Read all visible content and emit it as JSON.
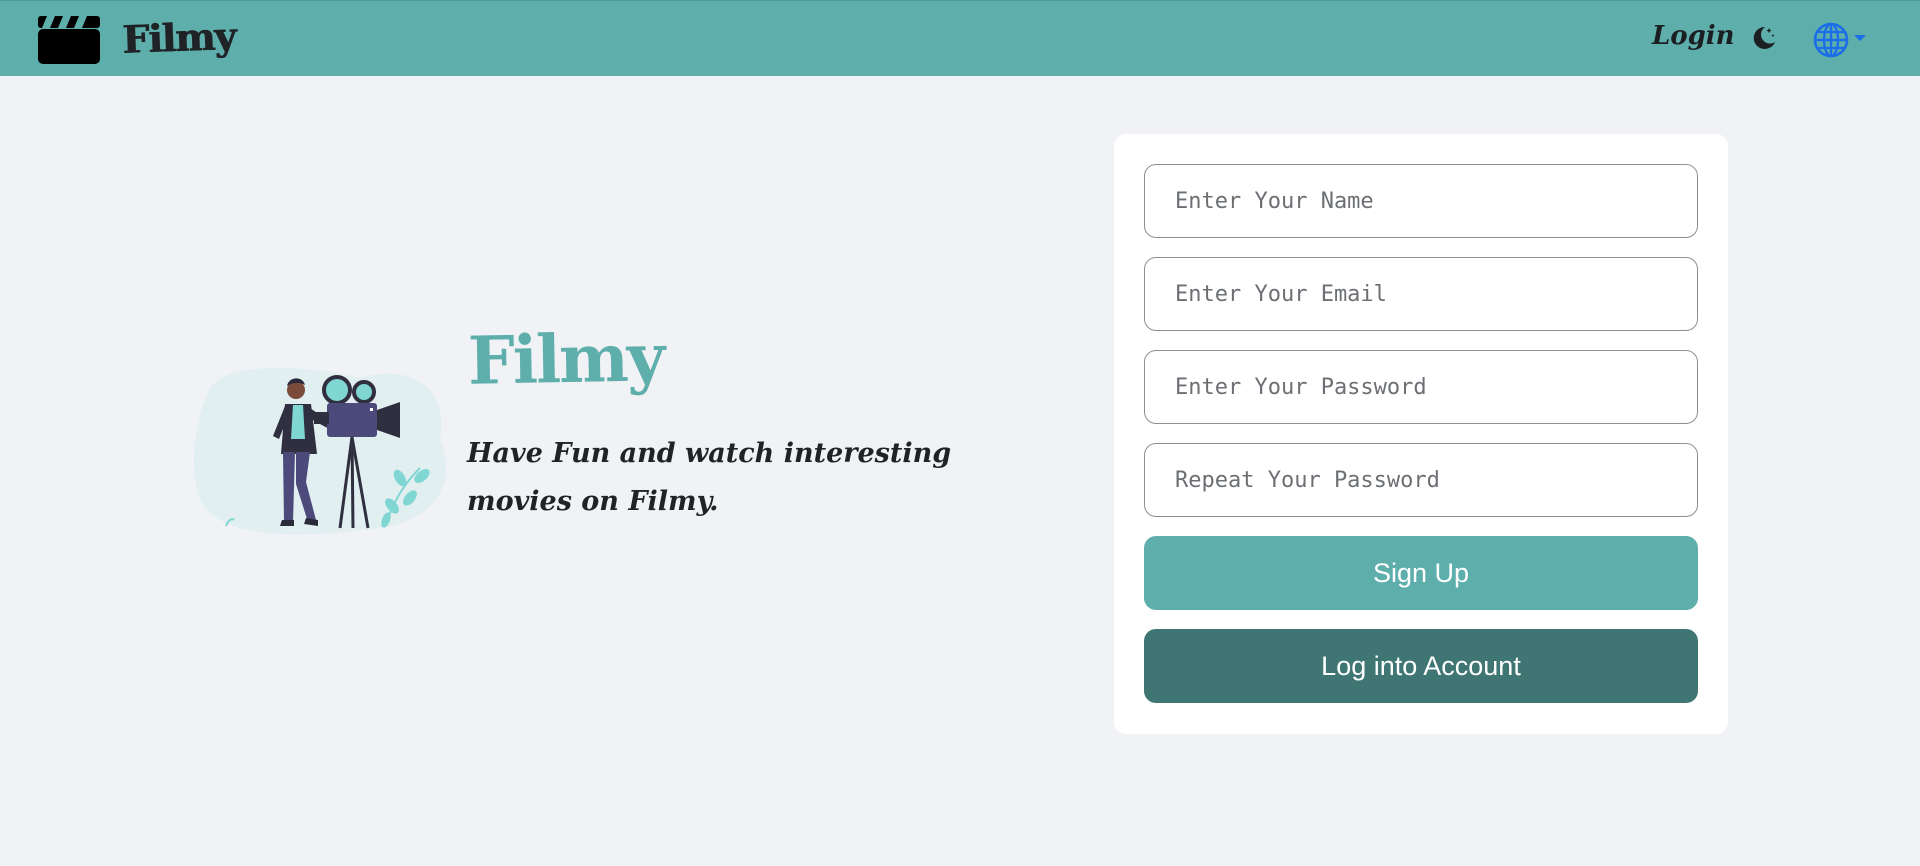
{
  "navbar": {
    "brand": "Filmy",
    "login_label": "Login",
    "icons": {
      "brand": "clapperboard-icon",
      "theme": "moon-icon",
      "language": "globe-icon"
    },
    "colors": {
      "background": "#5eaeac",
      "globe": "#1a6ee8"
    }
  },
  "hero": {
    "logo": "Filmy",
    "tagline": "Have Fun and watch interesting movies on Filmy."
  },
  "form": {
    "name_placeholder": "Enter Your Name",
    "email_placeholder": "Enter Your Email",
    "password_placeholder": "Enter Your Password",
    "repeat_password_placeholder": "Repeat Your Password",
    "signup_label": "Sign Up",
    "login_label": "Log into Account"
  },
  "colors": {
    "accent": "#5eaeac",
    "accent_dark": "#3f7674",
    "page_background": "#f0f2f5"
  }
}
